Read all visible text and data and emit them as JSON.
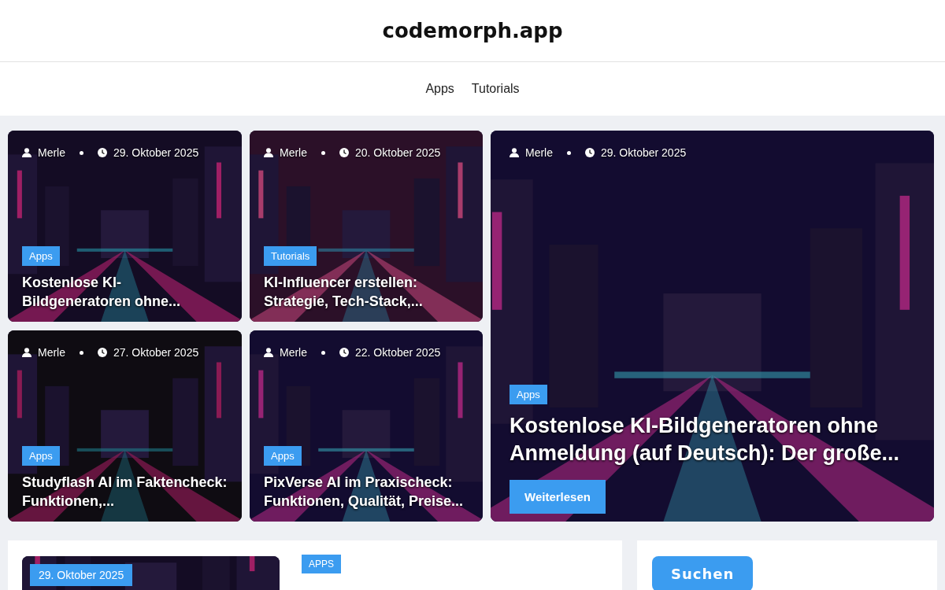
{
  "site": {
    "title": "codemorph.app"
  },
  "nav": [
    {
      "label": "Apps"
    },
    {
      "label": "Tutorials"
    }
  ],
  "posts": [
    {
      "author": "Merle",
      "date": "29. Oktober 2025",
      "category": "Apps",
      "title": "Kostenlose KI-Bildgeneratoren ohne..."
    },
    {
      "author": "Merle",
      "date": "20. Oktober 2025",
      "category": "Tutorials",
      "title": "KI-Influencer erstellen: Strategie, Tech-Stack,..."
    },
    {
      "author": "Merle",
      "date": "27. Oktober 2025",
      "category": "Apps",
      "title": "Studyflash AI im Faktencheck: Funktionen,..."
    },
    {
      "author": "Merle",
      "date": "22. Oktober 2025",
      "category": "Apps",
      "title": "PixVerse AI im Praxischeck: Funktionen, Qualität, Preise..."
    }
  ],
  "featured": {
    "author": "Merle",
    "date": "29. Oktober 2025",
    "category": "Apps",
    "title": "Kostenlose KI-Bildgeneratoren ohne Anmeldung (auf Deutsch): Der große...",
    "button": "Weiterlesen"
  },
  "latest": {
    "date": "29. Oktober 2025",
    "category": "APPS"
  },
  "sidebar": {
    "search_button": "Suchen"
  }
}
